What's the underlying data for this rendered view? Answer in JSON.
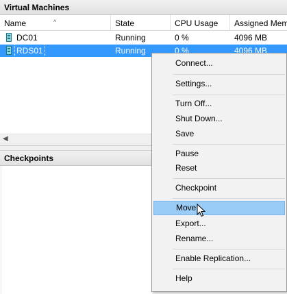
{
  "vm_panel": {
    "title": "Virtual Machines",
    "columns": [
      "Name",
      "State",
      "CPU Usage",
      "Assigned Mem"
    ],
    "rows": [
      {
        "name": "DC01",
        "state": "Running",
        "cpu": "0 %",
        "memory": "4096 MB",
        "selected": false
      },
      {
        "name": "RDS01",
        "state": "Running",
        "cpu": "0 %",
        "memory": "4096 MB",
        "selected": true
      }
    ]
  },
  "checkpoints_panel": {
    "title": "Checkpoints"
  },
  "context_menu": {
    "items": [
      {
        "label": "Connect...",
        "hover": false
      },
      {
        "label": "Settings...",
        "hover": false
      },
      {
        "label": "Turn Off...",
        "hover": false
      },
      {
        "label": "Shut Down...",
        "hover": false
      },
      {
        "label": "Save",
        "hover": false
      },
      {
        "label": "Pause",
        "hover": false
      },
      {
        "label": "Reset",
        "hover": false
      },
      {
        "label": "Checkpoint",
        "hover": false
      },
      {
        "label": "Move...",
        "hover": true
      },
      {
        "label": "Export...",
        "hover": false
      },
      {
        "label": "Rename...",
        "hover": false
      },
      {
        "label": "Enable Replication...",
        "hover": false
      },
      {
        "label": "Help",
        "hover": false
      }
    ]
  },
  "colors": {
    "selection": "#3399ff",
    "menu_hover": "#99ccf6",
    "menu_background": "#f2f2f2"
  }
}
